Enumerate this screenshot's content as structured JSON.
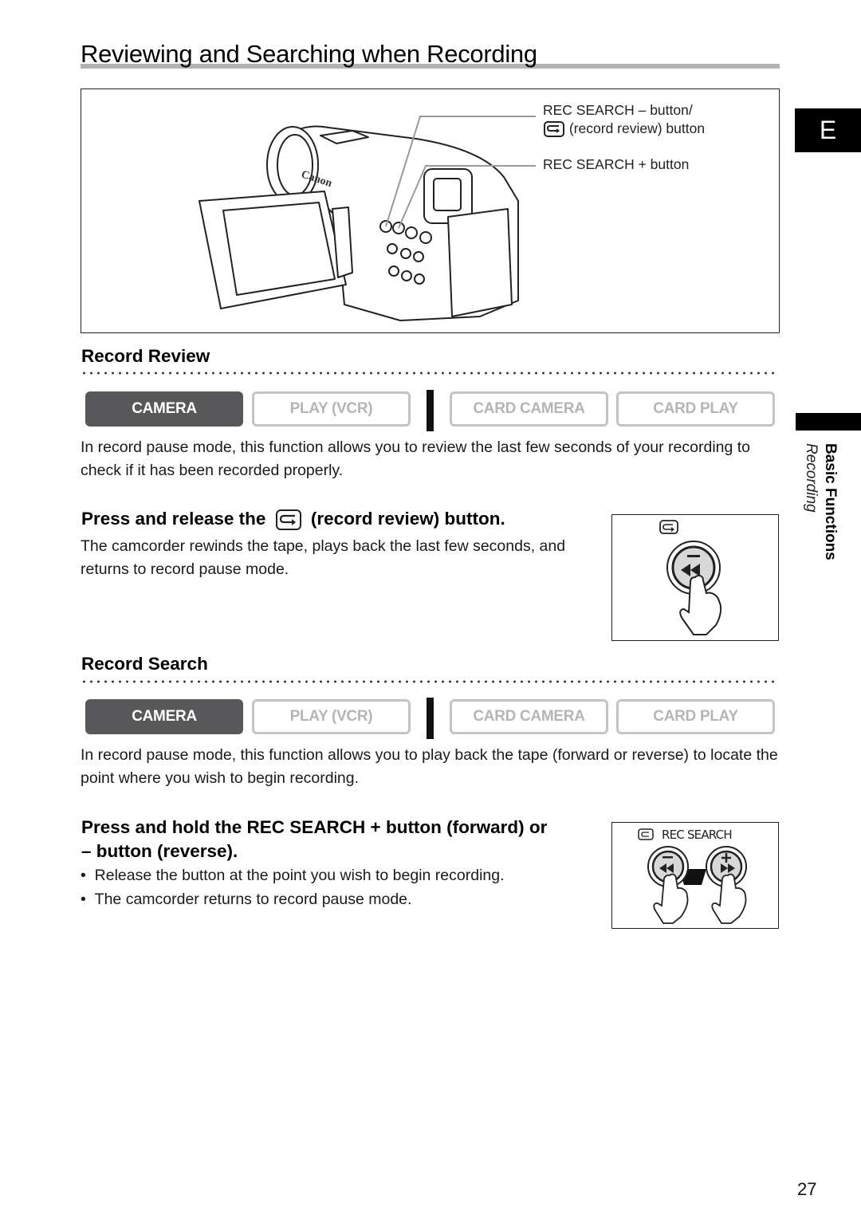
{
  "page": {
    "title": "Reviewing and Searching when Recording",
    "page_number": "27",
    "side_tab": {
      "language_letter": "E",
      "chapter": "Basic Functions",
      "section": "Recording"
    }
  },
  "main_figure": {
    "illustration": "canon-camcorder-with-open-lcd",
    "brand_label": "Canon",
    "callouts": [
      {
        "line1": "REC SEARCH – button/",
        "line2": "(record review) button",
        "icon": "record-review-icon"
      },
      {
        "line1": "REC SEARCH + button"
      }
    ]
  },
  "sections": [
    {
      "heading": "Record Review",
      "modes": [
        {
          "label": "CAMERA",
          "active": true
        },
        {
          "label": "PLAY (VCR)",
          "active": false
        },
        {
          "label": "CARD CAMERA",
          "active": false
        },
        {
          "label": "CARD PLAY",
          "active": false
        }
      ],
      "description": "In record pause mode, this function allows you to review the last few seconds of your recording to check if it has been recorded properly.",
      "step": {
        "prefix": "Press and release the",
        "icon": "record-review-icon",
        "suffix": "(record review) button.",
        "detail": "The camcorder rewinds the tape, plays back the last few seconds, and returns to record pause mode."
      },
      "figure": {
        "button_symbol": "–",
        "button_glyph": "◀◀",
        "icon": "record-review-icon"
      }
    },
    {
      "heading": "Record Search",
      "modes": [
        {
          "label": "CAMERA",
          "active": true
        },
        {
          "label": "PLAY (VCR)",
          "active": false
        },
        {
          "label": "CARD CAMERA",
          "active": false
        },
        {
          "label": "CARD PLAY",
          "active": false
        }
      ],
      "description": "In record pause mode, this function allows you to play back the tape (forward or reverse) to locate the point where you wish to begin recording.",
      "step": {
        "line1": "Press and hold the REC SEARCH + button (forward) or",
        "line2": "– button (reverse).",
        "bullets": [
          "Release the button at the point you wish to begin recording.",
          "The camcorder returns to record pause mode."
        ]
      },
      "figure": {
        "label": "REC SEARCH",
        "minus_symbol": "–",
        "plus_symbol": "+",
        "rew_glyph": "◀◀",
        "ff_glyph": "▶▶"
      }
    }
  ],
  "colors": {
    "active_mode_bg": "#58585a",
    "inactive_mode_border": "#c4c4c4",
    "inactive_mode_text": "#b5b5b5",
    "title_underline": "#b3b3b3",
    "tab_black": "#000000"
  }
}
